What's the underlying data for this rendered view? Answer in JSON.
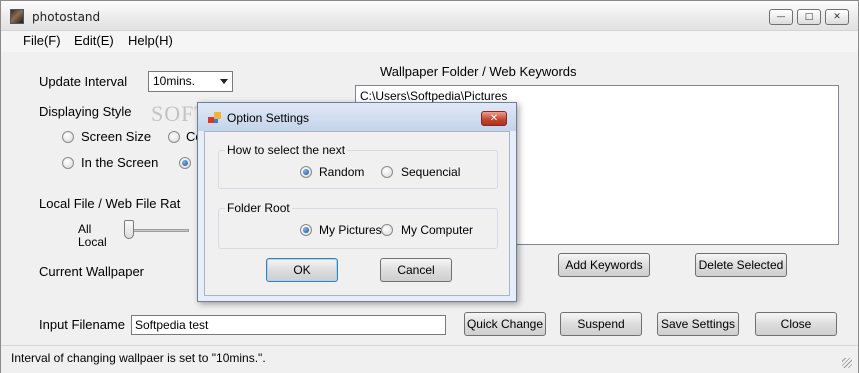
{
  "window": {
    "title": "photostand"
  },
  "menu": [
    "File(F)",
    "Edit(E)",
    "Help(H)"
  ],
  "caption_buttons": {
    "minimize": "—",
    "maximize": "□",
    "close": "✕"
  },
  "update_interval": {
    "label": "Update Interval",
    "value": "10mins."
  },
  "displaying_style": {
    "label": "Displaying Style",
    "options": [
      {
        "label": "Screen Size",
        "selected": false
      },
      {
        "label": "Co",
        "selected": false
      },
      {
        "label": "In the Screen",
        "selected": false
      },
      {
        "label": "",
        "selected": true
      }
    ]
  },
  "file_ratio": {
    "label": "Local File / Web File Rat",
    "left_label_1": "All",
    "left_label_2": "Local"
  },
  "current_wallpaper_label": "Current Wallpaper",
  "watermark": "SOFTPEDIA",
  "input_filename": {
    "label": "Input Filename",
    "value": "Softpedia test"
  },
  "wallpaper_folder": {
    "label": "Wallpaper Folder / Web Keywords",
    "items": [
      "C:\\Users\\Softpedia\\Pictures"
    ]
  },
  "buttons": {
    "add_keywords": "Add Keywords",
    "delete_selected": "Delete Selected",
    "quick_change": "Quick Change",
    "suspend": "Suspend",
    "save_settings": "Save Settings",
    "close": "Close"
  },
  "status": "Interval of changing wallpaer is set to \"10mins.\".",
  "dialog": {
    "title": "Option Settings",
    "close_glyph": "✕",
    "select_group": {
      "label": "How to select the next",
      "options": [
        {
          "label": "Random",
          "selected": true
        },
        {
          "label": "Sequencial",
          "selected": false
        }
      ]
    },
    "folder_group": {
      "label": "Folder Root",
      "options": [
        {
          "label": "My Pictures",
          "selected": true
        },
        {
          "label": "My Computer",
          "selected": false
        }
      ]
    },
    "ok": "OK",
    "cancel": "Cancel"
  },
  "colors": {
    "accent": "#1d4f8c",
    "dialog_close": "#c7472f",
    "dialog_frame": "#c5d4ea"
  }
}
